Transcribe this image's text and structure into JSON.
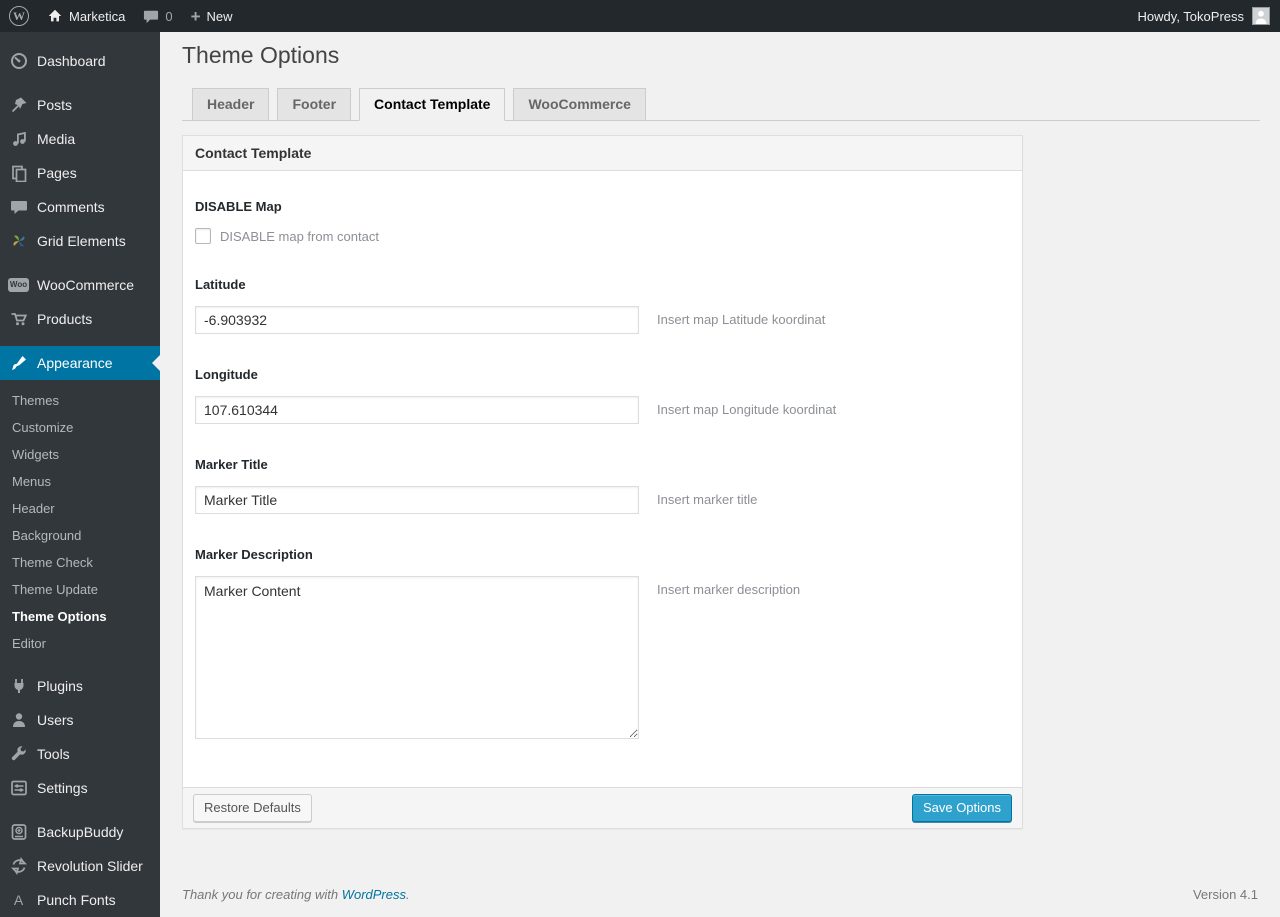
{
  "admin_bar": {
    "site_name": "Marketica",
    "comment_count": "0",
    "plus_glyph": "+",
    "new_label": "New",
    "howdy": "Howdy, TokoPress",
    "wp_logo_glyph": "W"
  },
  "sidebar": {
    "items": {
      "dashboard": "Dashboard",
      "posts": "Posts",
      "media": "Media",
      "pages": "Pages",
      "comments": "Comments",
      "grid_elements": "Grid Elements",
      "woocommerce": "WooCommerce",
      "products": "Products",
      "appearance": "Appearance",
      "plugins": "Plugins",
      "users": "Users",
      "tools": "Tools",
      "settings": "Settings",
      "backupbuddy": "BackupBuddy",
      "revolution_slider": "Revolution Slider",
      "punch_fonts": "Punch Fonts"
    },
    "appearance_submenu": {
      "themes": "Themes",
      "customize": "Customize",
      "widgets": "Widgets",
      "menus": "Menus",
      "header": "Header",
      "background": "Background",
      "theme_check": "Theme Check",
      "theme_update": "Theme Update",
      "theme_options": "Theme Options",
      "editor": "Editor"
    },
    "icons": {
      "woo_badge_text": "Woo",
      "punch_fonts_glyph": "A"
    }
  },
  "page": {
    "title": "Theme Options",
    "tabs": [
      {
        "label": "Header",
        "active": false
      },
      {
        "label": "Footer",
        "active": false
      },
      {
        "label": "Contact Template",
        "active": true
      },
      {
        "label": "WooCommerce",
        "active": false
      }
    ],
    "panel": {
      "title": "Contact Template",
      "fields": {
        "disable_map": {
          "label": "DISABLE Map",
          "checkbox_label": "DISABLE map from contact",
          "checked": false
        },
        "latitude": {
          "label": "Latitude",
          "value": "-6.903932",
          "hint": "Insert map Latitude koordinat"
        },
        "longitude": {
          "label": "Longitude",
          "value": "107.610344",
          "hint": "Insert map Longitude koordinat"
        },
        "marker_title": {
          "label": "Marker Title",
          "value": "Marker Title",
          "hint": "Insert marker title"
        },
        "marker_description": {
          "label": "Marker Description",
          "value": "Marker Content",
          "hint": "Insert marker description"
        }
      },
      "footer": {
        "restore_label": "Restore Defaults",
        "save_label": "Save Options"
      }
    }
  },
  "footer": {
    "thanks_prefix": "Thank you for creating with ",
    "link_text": "WordPress",
    "suffix": ".",
    "version": "Version 4.1"
  },
  "colors": {
    "accent_blue": "#0074a2",
    "button_primary": "#2ea2cc",
    "admin_bar_bg": "#23282d",
    "sidebar_bg": "#32373c",
    "content_bg": "#f1f1f1"
  }
}
